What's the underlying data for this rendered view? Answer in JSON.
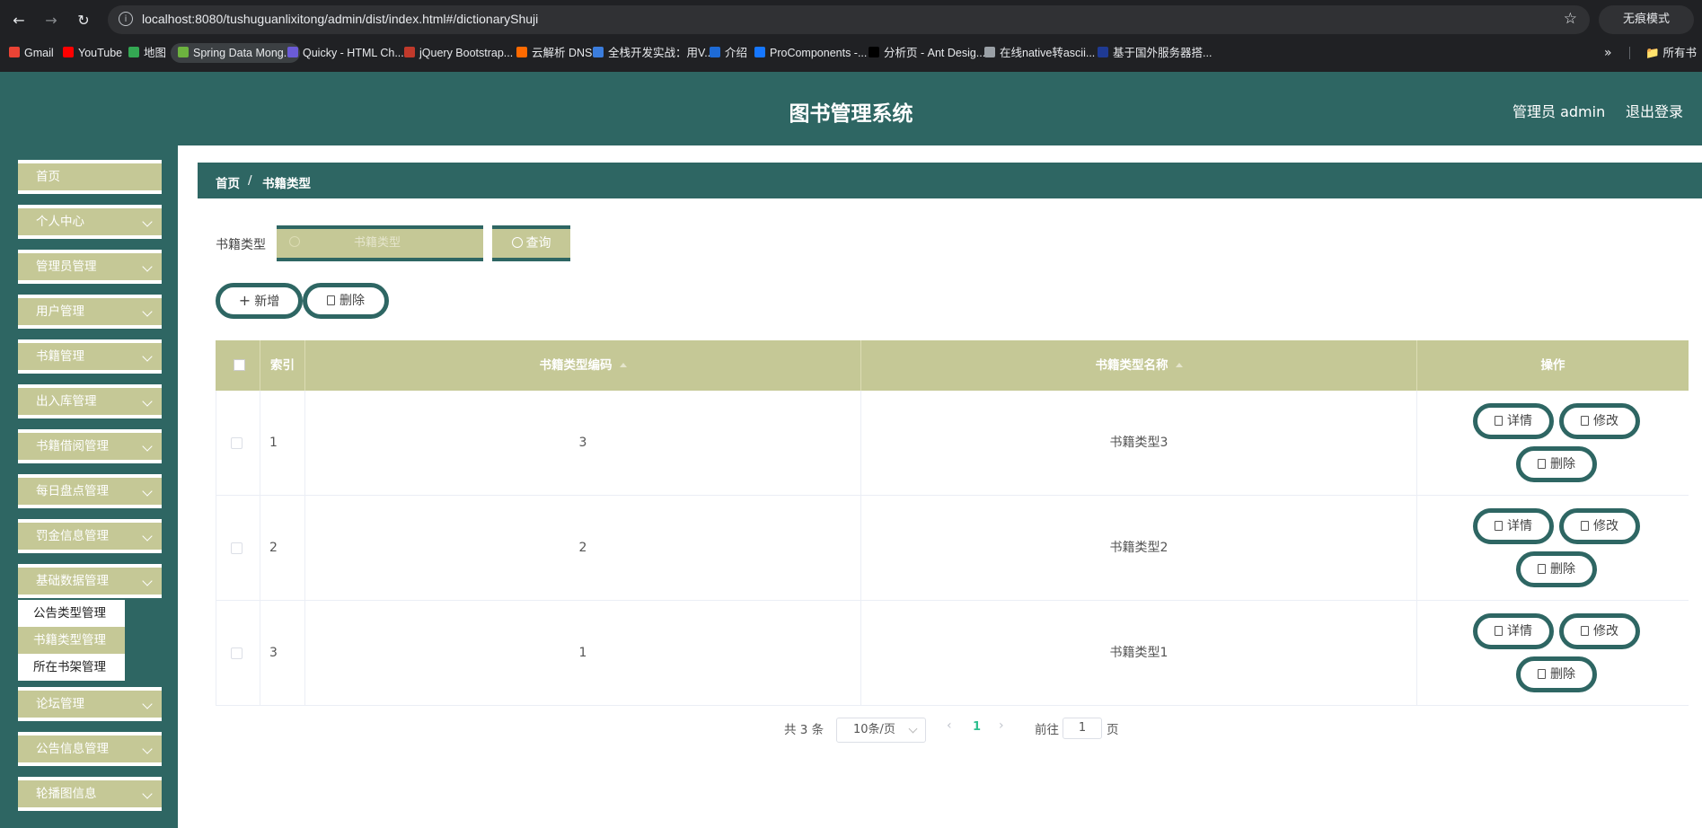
{
  "browser": {
    "url": "localhost:8080/tushuguanlixitong/admin/dist/index.html#/dictionaryShuji",
    "incognito_label": "无痕模式",
    "bookmarks": [
      {
        "label": "Gmail",
        "color": "#ea4335"
      },
      {
        "label": "YouTube",
        "color": "#ff0000"
      },
      {
        "label": "地图",
        "color": "#34a853"
      },
      {
        "label": "Spring Data Mong...",
        "color": "#6db33f"
      },
      {
        "label": "Quicky - HTML Ch...",
        "color": "#6b5bd6"
      },
      {
        "label": "jQuery Bootstrap...",
        "color": "#c0392b"
      },
      {
        "label": "云解析 DNS",
        "color": "#ff6a00"
      },
      {
        "label": "全栈开发实战：用V...",
        "color": "#3b7ddd"
      },
      {
        "label": "介绍",
        "color": "#1e6bd6"
      },
      {
        "label": "ProComponents -...",
        "color": "#1677ff"
      },
      {
        "label": "分析页 - Ant Desig...",
        "color": "#000000"
      },
      {
        "label": "在线native转ascii...",
        "color": "#9aa0a6"
      },
      {
        "label": "基于国外服务器搭...",
        "color": "#1f3a93"
      }
    ],
    "bookmarks_folder": "所有书"
  },
  "header": {
    "title": "图书管理系统",
    "user": "管理员 admin",
    "logout": "退出登录"
  },
  "sidebar": {
    "home": "首页",
    "menus": [
      "个人中心",
      "管理员管理",
      "用户管理",
      "书籍管理",
      "出入库管理",
      "书籍借阅管理",
      "每日盘点管理",
      "罚金信息管理",
      "基础数据管理"
    ],
    "submenu": [
      "公告类型管理",
      "书籍类型管理",
      "所在书架管理"
    ],
    "menus_after": [
      "论坛管理",
      "公告信息管理",
      "轮播图信息"
    ]
  },
  "breadcrumb": {
    "home": "首页",
    "separator": "/",
    "current": "书籍类型"
  },
  "search": {
    "label": "书籍类型",
    "placeholder": "书籍类型",
    "button": "查询"
  },
  "actions": {
    "add": "新增",
    "delete": "删除"
  },
  "table": {
    "columns": {
      "index": "索引",
      "code": "书籍类型编码",
      "name": "书籍类型名称",
      "ops": "操作"
    },
    "rows": [
      {
        "index": "1",
        "code": "3",
        "name": "书籍类型3"
      },
      {
        "index": "2",
        "code": "2",
        "name": "书籍类型2"
      },
      {
        "index": "3",
        "code": "1",
        "name": "书籍类型1"
      }
    ],
    "row_buttons": {
      "detail": "详情",
      "edit": "修改",
      "delete": "删除"
    }
  },
  "pagination": {
    "total": "共 3 条",
    "page_size": "10条/页",
    "current": "1",
    "goto_prefix": "前往",
    "goto_value": "1",
    "goto_suffix": "页"
  },
  "colors": {
    "primary": "#2e6663",
    "accent": "#c5c896",
    "page_active": "#2fbf8f"
  }
}
